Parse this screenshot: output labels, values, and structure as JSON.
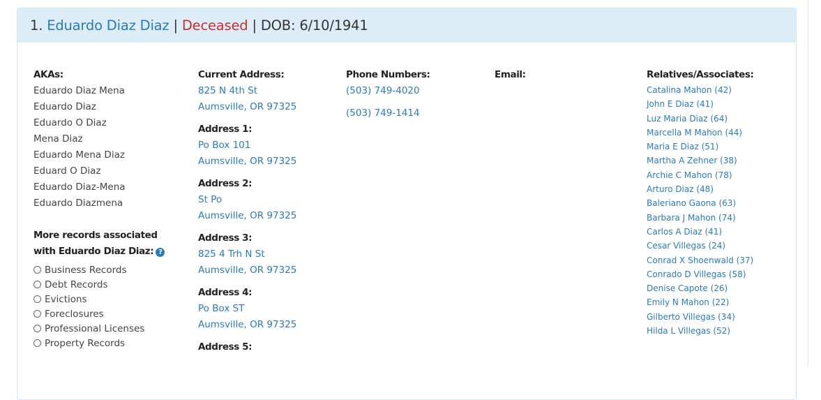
{
  "header": {
    "number": "1.",
    "name": "Eduardo Diaz Diaz",
    "separator1": " | ",
    "status": "Deceased",
    "separator2": " | ",
    "dob": "DOB: 6/10/1941"
  },
  "akas": {
    "label": "AKAs:",
    "items": [
      "Eduardo Diaz Mena",
      "Eduardo Diaz",
      "Eduardo O Diaz",
      "Mena Diaz",
      "Eduardo Mena Diaz",
      "Eduard O Diaz",
      "Eduardo Diaz-Mena",
      "Eduardo Diazmena"
    ]
  },
  "more_records": {
    "label_line1": "More records associated",
    "label_line2": "with Eduardo Diaz Diaz:",
    "help_icon": "?",
    "options": [
      "Business Records",
      "Debt Records",
      "Evictions",
      "Foreclosures",
      "Professional Licenses",
      "Property Records"
    ]
  },
  "addresses": [
    {
      "label": "Current Address:",
      "line1": "825 N 4th St",
      "line2": "Aumsville, OR 97325"
    },
    {
      "label": "Address 1:",
      "line1": "Po Box 101",
      "line2": "Aumsville, OR 97325"
    },
    {
      "label": "Address 2:",
      "line1": "St Po",
      "line2": "Aumsville, OR 97325"
    },
    {
      "label": "Address 3:",
      "line1": "825 4 Trh N St",
      "line2": "Aumsville, OR 97325"
    },
    {
      "label": "Address 4:",
      "line1": "Po Box ST",
      "line2": "Aumsville, OR 97325"
    },
    {
      "label": "Address 5:",
      "line1": "",
      "line2": ""
    }
  ],
  "phones": {
    "label": "Phone Numbers:",
    "items": [
      "(503) 749-4020",
      "(503) 749-1414"
    ]
  },
  "email": {
    "label": "Email:"
  },
  "relatives": {
    "label": "Relatives/Associates:",
    "items": [
      "Catalina Mahon (42)",
      "John E Diaz (41)",
      "Luz Maria Diaz (64)",
      "Marcella M Mahon (44)",
      "Maria E Diaz (51)",
      "Martha A Zehner (38)",
      "Archie C Mahon (78)",
      "Arturo Diaz (48)",
      "Baleriano Gaona (63)",
      "Barbara J Mahon (74)",
      "Carlos A Diaz (41)",
      "Cesar Villegas (24)",
      "Conrad X Shoenwald (37)",
      "Conrado D Villegas (58)",
      "Denise Capote (26)",
      "Emily N Mahon (22)",
      "Gilberto Villegas (34)",
      "Hilda L Villegas (52)"
    ]
  },
  "colors": {
    "header_bg": "#dcedf8",
    "link": "#2b7bb9",
    "deceased": "#c9302c"
  }
}
